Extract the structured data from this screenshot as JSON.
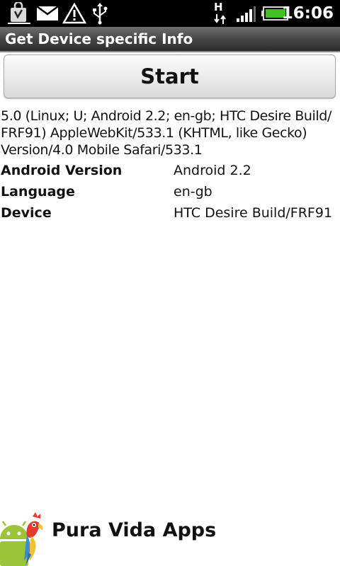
{
  "status_bar": {
    "time": "16:06",
    "network_type": "H",
    "icons": [
      "market-bag-icon",
      "mail-icon",
      "warning-icon",
      "usb-icon",
      "data-transfer-icon",
      "signal-icon",
      "battery-icon"
    ]
  },
  "title_bar": {
    "title": "Get Device specific Info"
  },
  "start_button": {
    "label": "Start"
  },
  "user_agent": {
    "lines": [
      "5.0 (Linux; U; Android 2.2; en-gb; HTC Desire Build/",
      "FRF91) AppleWebKit/533.1 (KHTML, like Gecko)",
      "Version/4.0 Mobile Safari/533.1"
    ]
  },
  "info_table": {
    "rows": [
      {
        "label": "Android Version",
        "value": "Android 2.2"
      },
      {
        "label": "Language",
        "value": "en-gb"
      },
      {
        "label": "Device",
        "value": "HTC Desire Build/FRF91"
      }
    ]
  },
  "footer": {
    "brand": "Pura Vida Apps",
    "logo": "android-parrot-logo"
  },
  "colors": {
    "status_bar_bg": "#000000",
    "title_bar_bg": "#4a4a4a",
    "battery_green": "#3fc21f",
    "android_green": "#9cc43a"
  }
}
